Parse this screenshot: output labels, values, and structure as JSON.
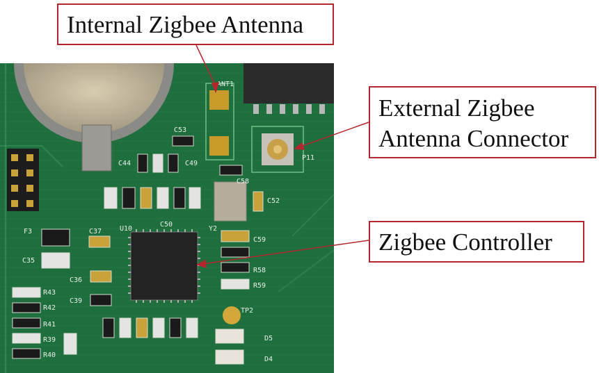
{
  "photo": {
    "subject": "green-pcb-zigbee-module",
    "silkscreen": {
      "u10": "U10",
      "c37": "C37",
      "c35": "C35",
      "c36": "C36",
      "c39": "C39",
      "c50": "C50",
      "c53": "C53",
      "c44": "C44",
      "c49": "C49",
      "c58": "C58",
      "c52": "C52",
      "c59": "C59",
      "r58": "R58",
      "r59": "R59",
      "r43": "R43",
      "r42": "R42",
      "r41": "R41",
      "r39": "R39",
      "r40": "R40",
      "d5": "D5",
      "d4": "D4",
      "tp2": "TP2",
      "ant1": "ANT1",
      "p11": "P11",
      "y2": "Y2",
      "f3": "F3"
    },
    "colors": {
      "board": "#1f6e3e",
      "callout_border": "#b3262d",
      "arrow": "#b3262d"
    }
  },
  "callouts": {
    "internal_antenna": "Internal Zigbee Antenna",
    "external_connector_line1": "External Zigbee",
    "external_connector_line2": "Antenna Connector",
    "controller": "Zigbee Controller"
  }
}
